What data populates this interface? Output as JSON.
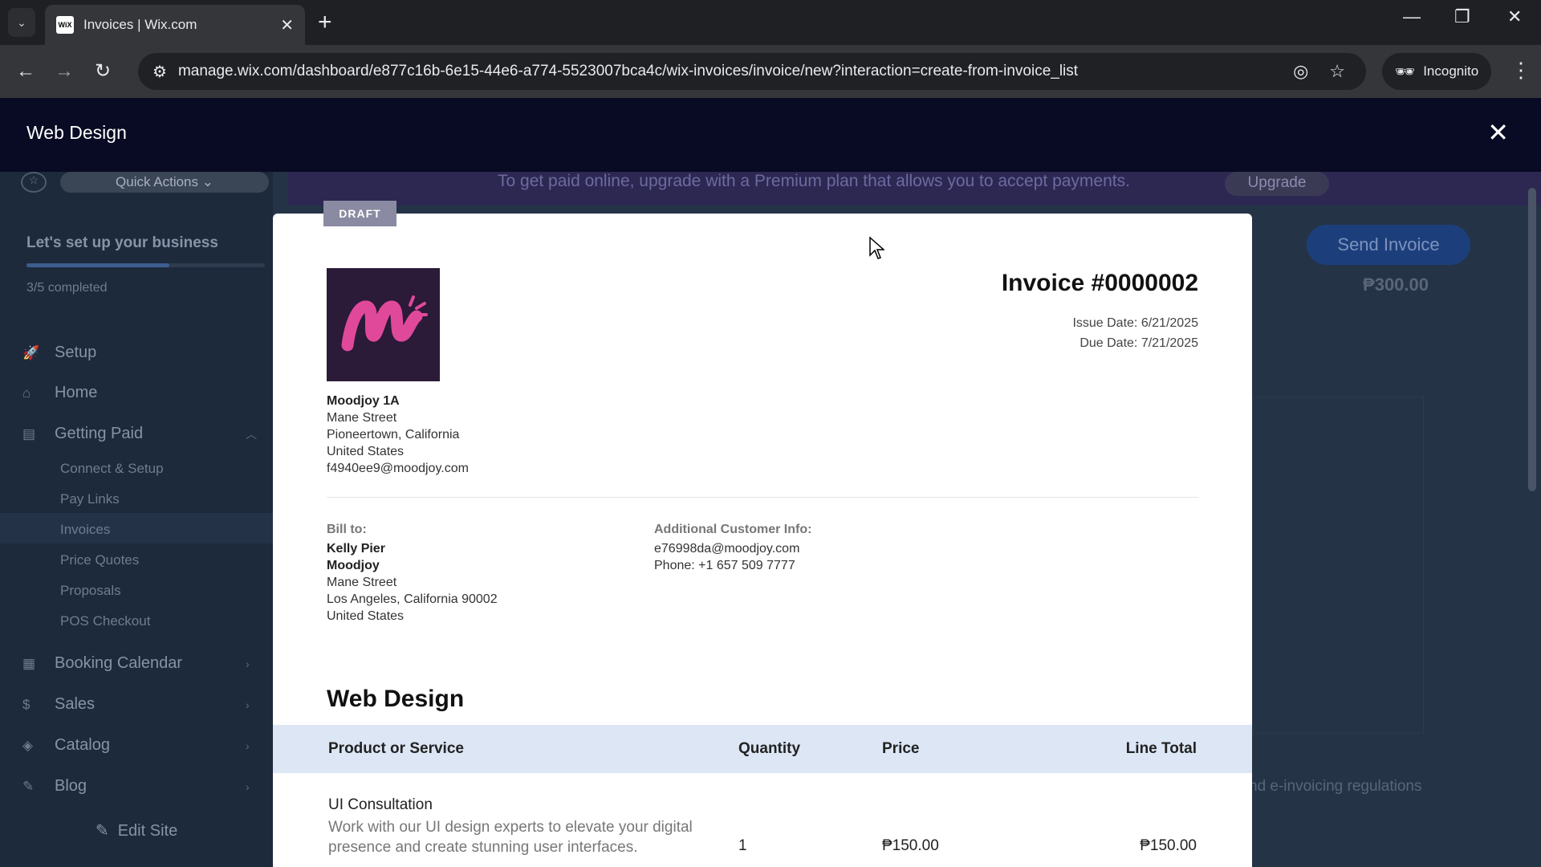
{
  "browser": {
    "tab_title": "Invoices | Wix.com",
    "favicon_text": "WiX",
    "url": "manage.wix.com/dashboard/e877c16b-6e15-44e6-a774-5523007bca4c/wix-invoices/invoice/new?interaction=create-from-invoice_list",
    "incognito_label": "Incognito"
  },
  "header": {
    "title": "Web Design"
  },
  "sidebar": {
    "quick_actions": "Quick Actions",
    "setup_title": "Let's set up your business",
    "progress": 0.6,
    "completed": "3/5 completed",
    "items": [
      {
        "label": "Setup",
        "icon": "rocket-icon"
      },
      {
        "label": "Home",
        "icon": "home-icon"
      },
      {
        "label": "Getting Paid",
        "icon": "receipt-icon"
      },
      {
        "label": "Booking Calendar",
        "icon": "calendar-icon"
      },
      {
        "label": "Sales",
        "icon": "dollar-icon"
      },
      {
        "label": "Catalog",
        "icon": "tag-icon"
      },
      {
        "label": "Blog",
        "icon": "pen-icon"
      }
    ],
    "sub_items": [
      "Connect & Setup",
      "Pay Links",
      "Invoices",
      "Price Quotes",
      "Proposals",
      "POS Checkout"
    ],
    "edit_site": "Edit Site"
  },
  "banner": {
    "text": "To get paid online, upgrade with a Premium plan that allows you to accept payments.",
    "upgrade_label": "Upgrade"
  },
  "background": {
    "send_invoice": "Send Invoice",
    "amount": "₱300.00",
    "regulations_text": "nd e-invoicing regulations"
  },
  "invoice": {
    "status": "DRAFT",
    "number": "Invoice #0000002",
    "issue_date": "Issue Date: 6/21/2025",
    "due_date": "Due Date: 7/21/2025",
    "business": {
      "name": "Moodjoy 1A",
      "street": "Mane Street",
      "city": "Pioneertown, California",
      "country": "United States",
      "email": "f4940ee9@moodjoy.com"
    },
    "bill_to": {
      "label": "Bill to:",
      "name": "Kelly Pier",
      "company": "Moodjoy",
      "street": "Mane Street",
      "city": "Los Angeles, California 90002",
      "country": "United States"
    },
    "additional": {
      "label": "Additional Customer Info:",
      "email": "e76998da@moodjoy.com",
      "phone": "Phone: +1 657 509 7777"
    },
    "project_title": "Web Design",
    "columns": [
      "Product or Service",
      "Quantity",
      "Price",
      "Line Total"
    ],
    "line_items": [
      {
        "name": "UI Consultation",
        "description": "Work with our UI design experts to elevate your digital presence and create stunning user interfaces.",
        "quantity": "1",
        "price": "₱150.00",
        "total": "₱150.00"
      }
    ]
  },
  "colors": {
    "app_header": "#090b24",
    "table_header": "#dce6f5",
    "draft_badge": "#8a8aa2",
    "logo_pink": "#e0499a"
  }
}
